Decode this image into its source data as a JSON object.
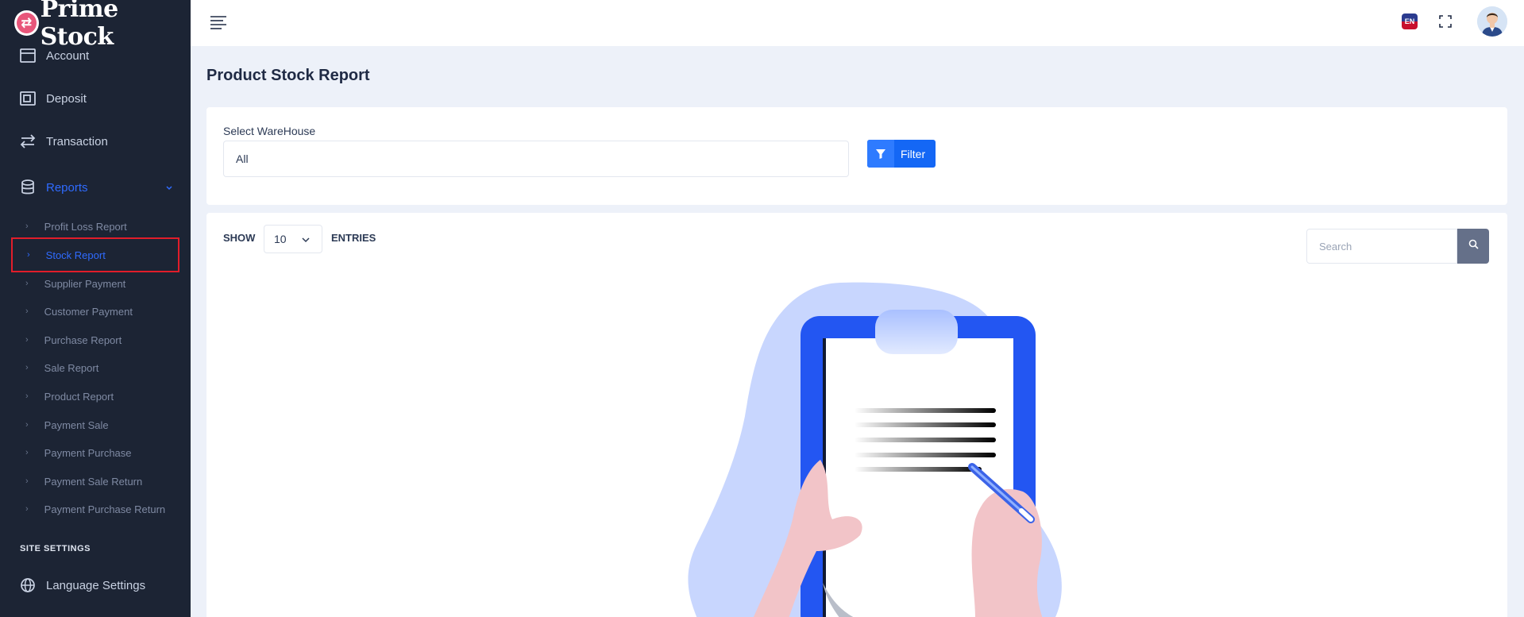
{
  "brand": {
    "name": "Prime Stock"
  },
  "sidebar": {
    "items": [
      {
        "label": "Account",
        "icon": "wallet-icon"
      },
      {
        "label": "Deposit",
        "icon": "deposit-icon"
      },
      {
        "label": "Transaction",
        "icon": "transfer-icon"
      },
      {
        "label": "Reports",
        "icon": "database-icon",
        "expanded": true
      }
    ],
    "report_items": [
      {
        "label": "Profit Loss Report"
      },
      {
        "label": "Stock Report",
        "active": true
      },
      {
        "label": "Supplier Payment"
      },
      {
        "label": "Customer Payment"
      },
      {
        "label": "Purchase Report"
      },
      {
        "label": "Sale Report"
      },
      {
        "label": "Product Report"
      },
      {
        "label": "Payment Sale"
      },
      {
        "label": "Payment Purchase"
      },
      {
        "label": "Payment Sale Return"
      },
      {
        "label": "Payment Purchase Return"
      }
    ],
    "section_label": "SITE SETTINGS",
    "settings_items": [
      {
        "label": "Language Settings",
        "icon": "globe-icon"
      }
    ]
  },
  "topbar": {
    "language": "EN"
  },
  "page": {
    "title": "Product Stock Report"
  },
  "filter": {
    "warehouse_label": "Select WareHouse",
    "warehouse_value": "All",
    "filter_button": "Filter"
  },
  "table": {
    "show_label": "SHOW",
    "entries_value": "10",
    "entries_label": "ENTRIES",
    "search_placeholder": "Search"
  },
  "colors": {
    "sidebar_bg": "#1c2434",
    "accent": "#2f6bff",
    "highlight_border": "#e11d2a",
    "page_bg": "#edf1f9"
  }
}
